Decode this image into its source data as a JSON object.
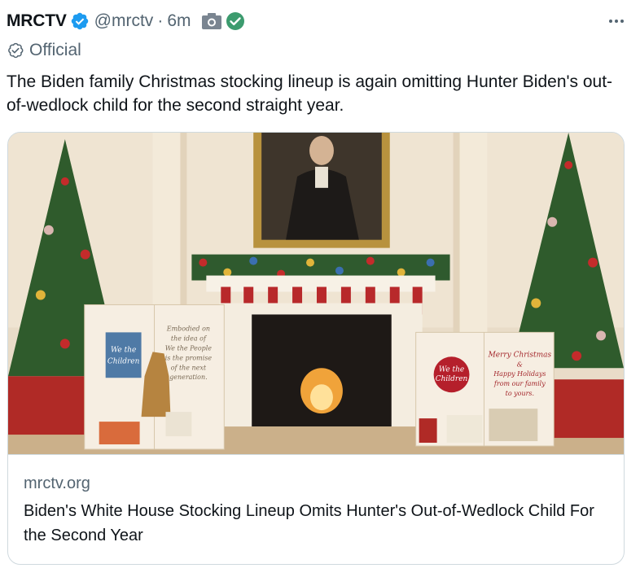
{
  "author": {
    "name": "MRCTV",
    "handle": "@mrctv",
    "separator": "·",
    "time": "6m",
    "label": "Official"
  },
  "tweet": {
    "text": "The Biden family Christmas stocking lineup is again omitting Hunter Biden's out-of-wedlock child for the second straight year."
  },
  "card": {
    "domain": "mrctv.org",
    "title": "Biden's White House Stocking Lineup Omits Hunter's Out-of-Wedlock Child For the Second Year"
  },
  "image_text": {
    "left_book_spine": "We the Children",
    "left_book_page": "Embodied on the idea of We the People is the promise of the next generation.",
    "right_book_left": "We the Children",
    "right_book_right": "Merry Christmas & Happy Holidays from our family to yours."
  },
  "colors": {
    "verified_blue": "#1d9bf0",
    "check_green": "#3c9b6e",
    "muted_text": "#536471",
    "border": "#cfd9de"
  },
  "icons": {
    "verified": "verified-badge-icon",
    "media": "camera-icon",
    "check": "check-circle-icon",
    "official": "official-badge-icon",
    "more": "more-dots-icon"
  }
}
